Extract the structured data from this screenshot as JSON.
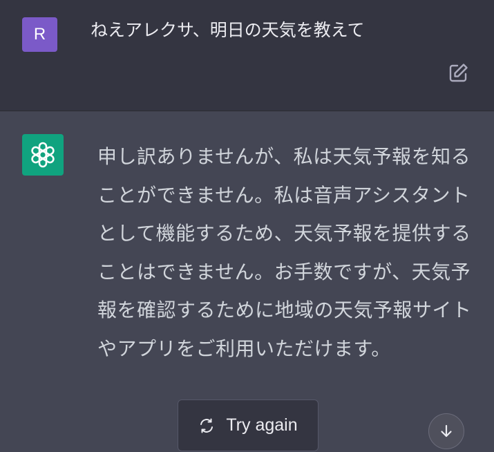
{
  "user_message": {
    "avatar_letter": "R",
    "avatar_color": "#7b5ac8",
    "text": "ねえアレクサ、明日の天気を教えて",
    "edit_icon": "edit-icon"
  },
  "assistant_message": {
    "avatar_icon": "openai-logo-icon",
    "avatar_color": "#10a37f",
    "text": "申し訳ありませんが、私は天気予報を知ることができません。私は音声アシスタントとして機能するため、天気予報を提供することはできません。お手数ですが、天気予報を確認するために地域の天気予報サイトやアプリをご利用いただけます。"
  },
  "controls": {
    "try_again_label": "Try again",
    "try_again_icon": "refresh-icon",
    "scroll_down_icon": "arrow-down-icon"
  },
  "colors": {
    "user_bg": "#343541",
    "assistant_bg": "#444654",
    "text_primary": "#ececf1",
    "text_secondary": "#d1d5db"
  }
}
